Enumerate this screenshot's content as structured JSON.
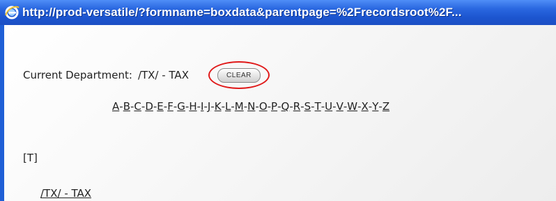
{
  "window": {
    "title": "http://prod-versatile/?formname=boxdata&parentpage=%2Frecordsroot%2F..."
  },
  "page": {
    "current_department_label": "Current Department:",
    "current_department_value": "/TX/ - TAX",
    "clear_button_label": "CLEAR",
    "alphabet": [
      "A",
      "B",
      "C",
      "D",
      "E",
      "F",
      "G",
      "H",
      "I",
      "J",
      "K",
      "L",
      "M",
      "N",
      "O",
      "P",
      "Q",
      "R",
      "S",
      "T",
      "U",
      "V",
      "W",
      "X",
      "Y",
      "Z"
    ],
    "alphabet_separator": "-",
    "section_header": "[T]",
    "department_link": "/TX/ - TAX"
  },
  "colors": {
    "titlebar": "#2a67e0",
    "highlight_ring": "#e01a1a"
  },
  "icons": {
    "title_icon": "internet-explorer-icon"
  }
}
